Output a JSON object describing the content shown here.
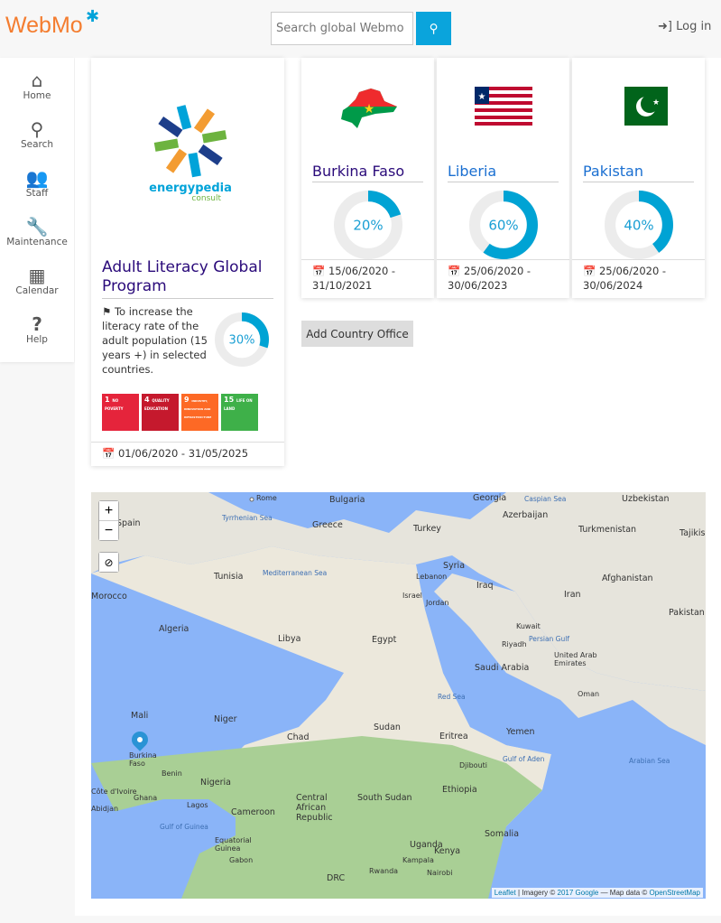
{
  "header": {
    "logo": "WebMo",
    "search_placeholder": "Search global Webmo",
    "login": "Log in"
  },
  "sidebar": {
    "items": [
      {
        "label": "Home",
        "icon": "home-icon"
      },
      {
        "label": "Search",
        "icon": "search-icon"
      },
      {
        "label": "Staff",
        "icon": "users-icon"
      },
      {
        "label": "Maintenance",
        "icon": "wrench-icon"
      },
      {
        "label": "Calendar",
        "icon": "calendar-icon"
      },
      {
        "label": "Help",
        "icon": "question-icon"
      }
    ]
  },
  "program": {
    "logo_text": "energypedia",
    "logo_sub": "consult",
    "title": "Adult Literacy Global Program",
    "description": "To increase the literacy rate of the adult population (15 years +) in selected countries.",
    "progress": 30,
    "progress_label": "30%",
    "dates": "01/06/2020 - 31/05/2025",
    "sdgs": [
      {
        "num": "1",
        "name": "NO POVERTY",
        "color": "#e5243b"
      },
      {
        "num": "4",
        "name": "QUALITY EDUCATION",
        "color": "#c5192d"
      },
      {
        "num": "9",
        "name": "INDUSTRY, INNOVATION AND INFRASTRUCTURE",
        "color": "#fd6925"
      },
      {
        "num": "15",
        "name": "LIFE ON LAND",
        "color": "#3eb049"
      }
    ]
  },
  "countries": [
    {
      "name": "Burkina Faso",
      "progress": 20,
      "progress_label": "20%",
      "dates": "15/06/2020 - 31/10/2021"
    },
    {
      "name": "Liberia",
      "progress": 60,
      "progress_label": "60%",
      "dates": "25/06/2020 - 30/06/2023"
    },
    {
      "name": "Pakistan",
      "progress": 40,
      "progress_label": "40%",
      "dates": "25/06/2020 - 30/06/2024"
    }
  ],
  "add_country_office": "Add Country Office",
  "map": {
    "labels": [
      "Bulgaria",
      "Georgia",
      "Uzbekistan",
      "Spain",
      "Rome",
      "Tyrrhenian Sea",
      "Greece",
      "Turkey",
      "Azerbaijan",
      "Turkmenistan",
      "Tunisia",
      "Mediterranean Sea",
      "Syria",
      "Lebanon",
      "Iraq",
      "Afghanistan",
      "Morocco",
      "Israel",
      "Jordan",
      "Iran",
      "Algeria",
      "Libya",
      "Egypt",
      "Kuwait",
      "Riyadh",
      "Saudi Arabia",
      "United Arab Emirates",
      "Pakistan",
      "Mali",
      "Niger",
      "Chad",
      "Sudan",
      "Red Sea",
      "Oman",
      "Eritrea",
      "Yemen",
      "Burkina Faso",
      "Djibouti",
      "Gulf of Aden",
      "Arabian Sea",
      "Benin",
      "Nigeria",
      "Ethiopia",
      "Côte d'Ivoire",
      "Ghana",
      "Lagos",
      "Cameroon",
      "Central African Republic",
      "South Sudan",
      "Somalia",
      "Abidjan",
      "Gulf of Guinea",
      "Equatorial Guinea",
      "Uganda",
      "Kenya",
      "Gabon",
      "Kampala",
      "Rwanda",
      "Nairobi",
      "DRC",
      "Persian Gulf",
      "Caspian Sea",
      "Tajikis"
    ],
    "attribution": {
      "leaflet": "Leaflet",
      "imagery": "| Imagery ©",
      "google": "2017 Google",
      "mapdata": "— Map data ©",
      "osm": "OpenStreetMap"
    },
    "marker": "Burkina Faso"
  }
}
